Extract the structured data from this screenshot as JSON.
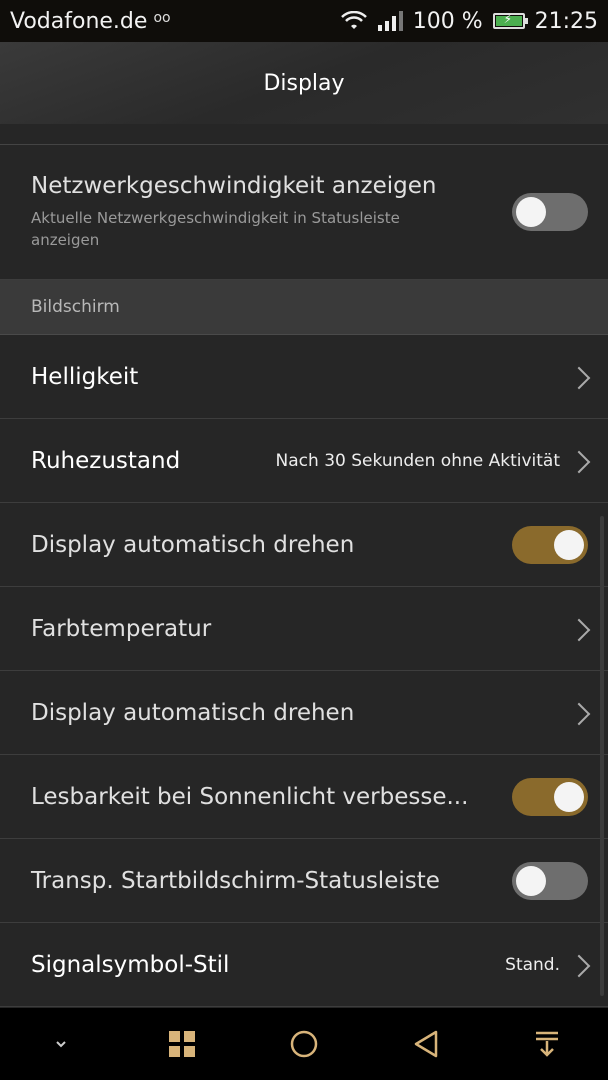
{
  "status_bar": {
    "carrier": "Vodafone.de",
    "voicemail_icon": "voicemail-icon",
    "battery_percent": "100 %",
    "time": "21:25"
  },
  "header": {
    "title": "Display"
  },
  "network_speed": {
    "title": "Netzwerkgeschwindigkeit anzeigen",
    "subtitle": "Aktuelle Netzwerkgeschwindigkeit in Statusleiste anzeigen",
    "enabled": false
  },
  "section": {
    "label": "Bildschirm"
  },
  "rows": [
    {
      "title": "Helligkeit",
      "value": "",
      "type": "link"
    },
    {
      "title": "Ruhezustand",
      "value": "Nach 30 Sekunden ohne Aktivität",
      "type": "link"
    },
    {
      "title": "Display automatisch drehen",
      "value": "",
      "type": "toggle",
      "enabled": true
    },
    {
      "title": "Farbtemperatur",
      "value": "",
      "type": "link"
    },
    {
      "title": "Display automatisch drehen",
      "value": "",
      "type": "link"
    },
    {
      "title": "Lesbarkeit bei Sonnenlicht verbesse...",
      "value": "",
      "type": "toggle",
      "enabled": true
    },
    {
      "title": "Transp. Startbildschirm-Statusleiste",
      "value": "",
      "type": "toggle",
      "enabled": false
    },
    {
      "title": "Signalsymbol-Stil",
      "value": "Stand.",
      "type": "link"
    }
  ],
  "nav_bar": {
    "items": [
      "chevron-down-icon",
      "grid-icon",
      "home-circle-icon",
      "back-triangle-icon",
      "notification-pulldown-icon"
    ]
  },
  "colors": {
    "accent": "#8a6a2c",
    "background": "#262626",
    "section_header": "#3a3a3a"
  }
}
